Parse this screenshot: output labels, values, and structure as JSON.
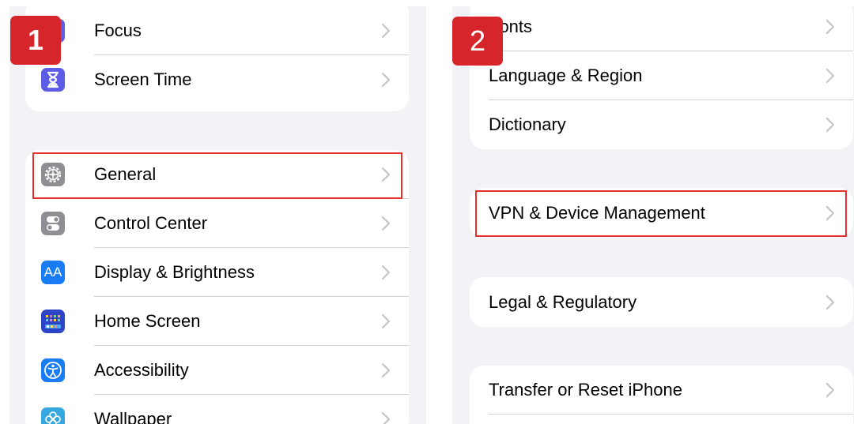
{
  "left_panel": {
    "group1": [
      {
        "label": "Focus",
        "icon": "moon-icon",
        "color": "#5d5ce6"
      },
      {
        "label": "Screen Time",
        "icon": "hourglass-icon",
        "color": "#5d5ce6"
      }
    ],
    "group2": [
      {
        "label": "General",
        "icon": "gear-icon",
        "color": "#8e8e93"
      },
      {
        "label": "Control Center",
        "icon": "toggles-icon",
        "color": "#8e8e93"
      },
      {
        "label": "Display & Brightness",
        "icon": "text-size-icon",
        "color": "#1a7cf5",
        "glyph": "AA"
      },
      {
        "label": "Home Screen",
        "icon": "home-screen-icon",
        "color": "#2d44c6"
      },
      {
        "label": "Accessibility",
        "icon": "accessibility-icon",
        "color": "#1a7cf5"
      },
      {
        "label": "Wallpaper",
        "icon": "flower-icon",
        "color": "#36a8e0"
      }
    ]
  },
  "right_panel": {
    "group1": [
      {
        "label": "Fonts"
      },
      {
        "label": "Language & Region"
      },
      {
        "label": "Dictionary"
      }
    ],
    "group2": [
      {
        "label": "VPN & Device Management"
      }
    ],
    "group3": [
      {
        "label": "Legal & Regulatory"
      }
    ],
    "group4": [
      {
        "label": "Transfer or Reset iPhone"
      }
    ]
  },
  "step_badges": [
    "1",
    "2"
  ],
  "highlight_color": "#e5322d",
  "badge_color": "#d7262b"
}
